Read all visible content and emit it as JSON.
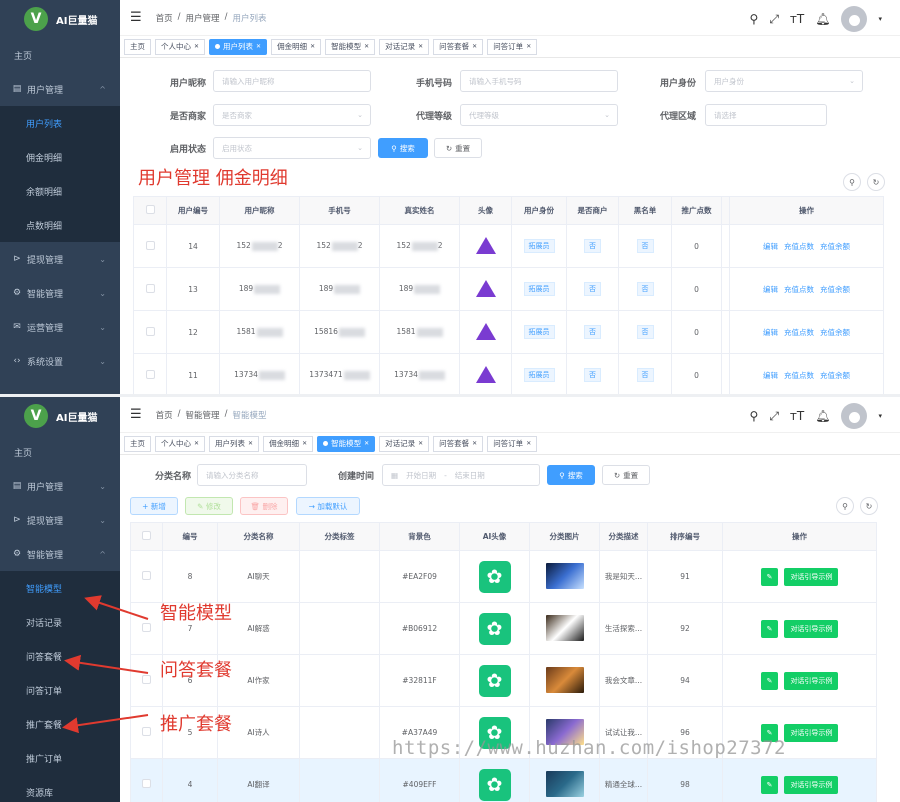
{
  "app_name": "AI巨量猫",
  "logo_letter": "V",
  "p1": {
    "sidebar": [
      {
        "label": "主页",
        "icon": "",
        "level": "top"
      },
      {
        "label": "用户管理",
        "icon": "▤",
        "level": "group",
        "arrow": "^"
      },
      {
        "label": "用户列表",
        "level": "sub",
        "active": true
      },
      {
        "label": "佣金明细",
        "level": "sub"
      },
      {
        "label": "余额明细",
        "level": "sub"
      },
      {
        "label": "点数明细",
        "level": "sub"
      },
      {
        "label": "提现管理",
        "icon": "⊳",
        "level": "group",
        "arrow": "⌄"
      },
      {
        "label": "智能管理",
        "icon": "⚙",
        "level": "group",
        "arrow": "⌄"
      },
      {
        "label": "运营管理",
        "icon": "✉",
        "level": "group",
        "arrow": "⌄"
      },
      {
        "label": "系统设置",
        "icon": "‹›",
        "level": "group",
        "arrow": "⌄"
      }
    ],
    "breadcrumb": [
      "首页",
      "/",
      "用户管理",
      "/",
      "用户列表"
    ],
    "tags": [
      "主页",
      "个人中心",
      "用户列表",
      "佣金明细",
      "智能模型",
      "对话记录",
      "问答套餐",
      "问答订单"
    ],
    "active_tag": 2,
    "form": {
      "nickname_label": "用户昵称",
      "nickname_ph": "请输入用户昵称",
      "phone_label": "手机号码",
      "phone_ph": "请输入手机号码",
      "identity_label": "用户身份",
      "identity_ph": "用户身份",
      "merchant_label": "是否商家",
      "merchant_ph": "是否商家",
      "agent_level_label": "代理等级",
      "agent_level_ph": "代理等级",
      "agent_area_label": "代理区域",
      "agent_area_ph": "请选择",
      "status_label": "启用状态",
      "status_ph": "启用状态",
      "search_btn": "搜索",
      "reset_btn": "重置"
    },
    "annotation": "用户管理 佣金明细",
    "table": {
      "headers": [
        "",
        "用户编号",
        "用户昵称",
        "手机号",
        "真实姓名",
        "头像",
        "用户身份",
        "是否商户",
        "黑名单",
        "推广点数",
        "",
        "操作"
      ],
      "rows": [
        {
          "id": "14",
          "nick_a": "152",
          "nick_b": "2",
          "phone_a": "152",
          "phone_b": "2",
          "name_a": "152",
          "name_b": "2",
          "role": "拓展员",
          "merchant": "否",
          "blacklist": "否",
          "points": "0"
        },
        {
          "id": "13",
          "nick_a": "189",
          "nick_b": "",
          "phone_a": "189",
          "phone_b": "",
          "name_a": "189",
          "name_b": "",
          "role": "拓展员",
          "merchant": "否",
          "blacklist": "否",
          "points": "0"
        },
        {
          "id": "12",
          "nick_a": "1581",
          "nick_b": "",
          "phone_a": "15816",
          "phone_b": "",
          "name_a": "1581",
          "name_b": "",
          "role": "拓展员",
          "merchant": "否",
          "blacklist": "否",
          "points": "0"
        },
        {
          "id": "11",
          "nick_a": "13734",
          "nick_b": "",
          "phone_a": "1373471",
          "phone_b": "",
          "name_a": "13734",
          "name_b": "",
          "role": "拓展员",
          "merchant": "否",
          "blacklist": "否",
          "points": "0"
        }
      ],
      "ops": [
        "编辑",
        "充值点数",
        "充值余额"
      ]
    }
  },
  "p2": {
    "sidebar": [
      {
        "label": "主页",
        "icon": "",
        "level": "top"
      },
      {
        "label": "用户管理",
        "icon": "▤",
        "level": "group",
        "arrow": "⌄"
      },
      {
        "label": "提现管理",
        "icon": "⊳",
        "level": "group",
        "arrow": "⌄"
      },
      {
        "label": "智能管理",
        "icon": "⚙",
        "level": "group",
        "arrow": "^"
      },
      {
        "label": "智能模型",
        "level": "sub",
        "active": true
      },
      {
        "label": "对话记录",
        "level": "sub"
      },
      {
        "label": "问答套餐",
        "level": "sub"
      },
      {
        "label": "问答订单",
        "level": "sub"
      },
      {
        "label": "推广套餐",
        "level": "sub"
      },
      {
        "label": "推广订单",
        "level": "sub"
      },
      {
        "label": "资源库",
        "level": "sub"
      }
    ],
    "breadcrumb": [
      "首页",
      "/",
      "智能管理",
      "/",
      "智能模型"
    ],
    "tags": [
      "主页",
      "个人中心",
      "用户列表",
      "佣金明细",
      "智能模型",
      "对话记录",
      "问答套餐",
      "问答订单"
    ],
    "active_tag": 4,
    "form": {
      "cat_label": "分类名称",
      "cat_ph": "请输入分类名称",
      "time_label": "创建时间",
      "start_ph": "开始日期",
      "dash": "-",
      "end_ph": "结束日期",
      "search_btn": "搜索",
      "reset_btn": "重置"
    },
    "toolbar": [
      "新增",
      "修改",
      "删除",
      "加载默认"
    ],
    "annotations": [
      "智能模型",
      "问答套餐",
      "推广套餐"
    ],
    "table": {
      "headers": [
        "",
        "编号",
        "分类名称",
        "分类标签",
        "背景色",
        "AI头像",
        "分类图片",
        "分类描述",
        "排序编号",
        "操作"
      ],
      "rows": [
        {
          "id": "8",
          "name": "AI聊天",
          "color": "#EA2F09",
          "desc": "我是知天...",
          "order": "91"
        },
        {
          "id": "7",
          "name": "AI解惑",
          "color": "#B06912",
          "desc": "生活探索...",
          "order": "92"
        },
        {
          "id": "6",
          "name": "AI作家",
          "color": "#32811F",
          "desc": "我会文章...",
          "order": "94"
        },
        {
          "id": "5",
          "name": "AI诗人",
          "color": "#A37A49",
          "desc": "试试让我...",
          "order": "96"
        },
        {
          "id": "4",
          "name": "AI翻译",
          "color": "#409EFF",
          "desc": "精通全球...",
          "order": "98"
        }
      ],
      "op_btn": "对话引导示例"
    }
  },
  "watermark": "https://www.huzhan.com/ishop27372"
}
